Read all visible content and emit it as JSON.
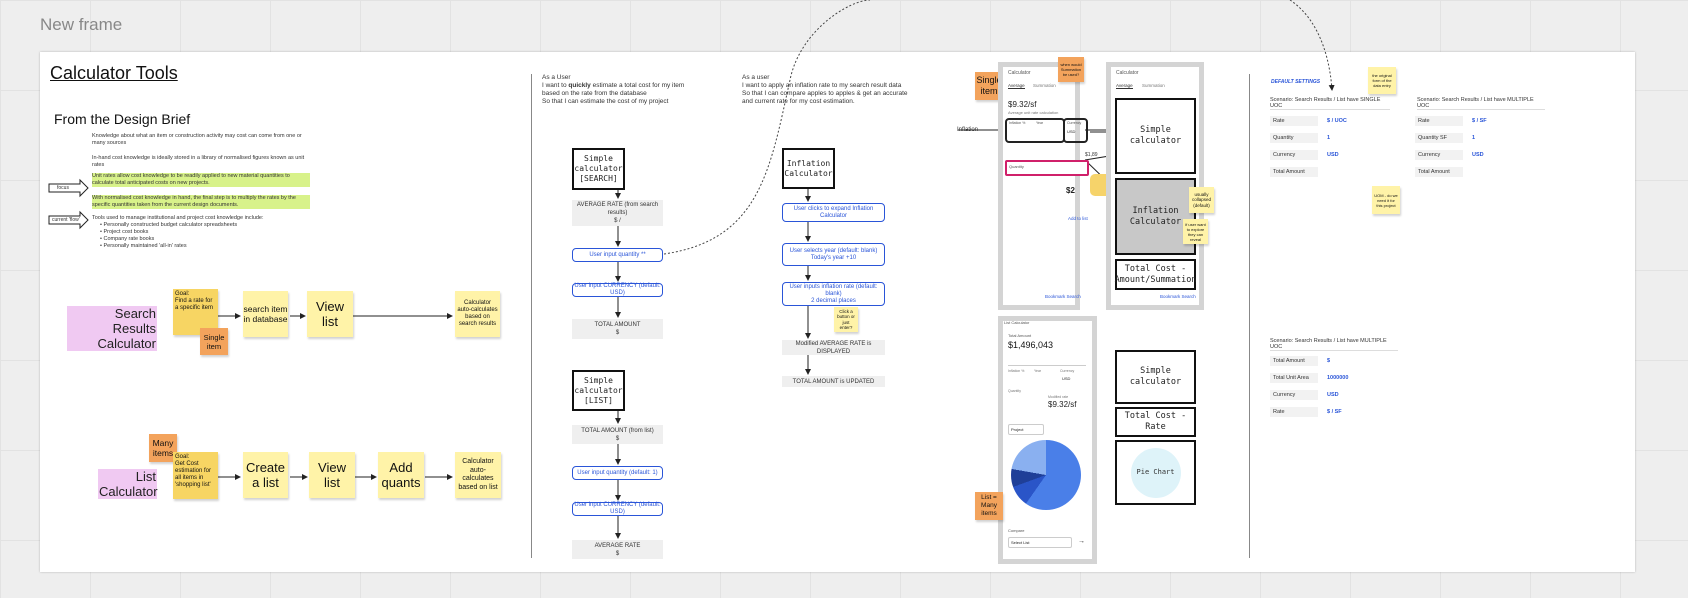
{
  "frame_label": "New frame",
  "title": "Calculator Tools",
  "design_brief": {
    "heading": "From the Design Brief",
    "para1": "Knowledge about what an item or construction activity may cost can come from one or many sources",
    "para2": "In-hand cost knowledge is ideally stored in a library of normalised figures known as unit rates",
    "para3": "Unit rates allow cost knowledge to be readily applied to new material quantities to calculate total anticipated costs on new projects.",
    "para4": "With normalised cost knowledge in hand, the final step is to multiply the rates by the specific quantities taken from the current design documents.",
    "para5": "Tools used to manage institutional and project cost knowledge include:",
    "bullets": [
      "Personally constructed budget calculator spreadsheets",
      "Project cost books",
      "Company rate books",
      "Personally maintained 'all-in' rates"
    ],
    "arrow1": "focus",
    "arrow2": "current 'flow'"
  },
  "search_flow": {
    "label": "Search Results Calculator",
    "goal": "Goal:\nFind a rate for a specific item",
    "single": "Single item",
    "step1": "search item in database",
    "step2": "View list",
    "result": "Calculator auto-calculates based on search results"
  },
  "list_flow": {
    "label": "List Calculator",
    "many": "Many items",
    "goal": "Goal:\nGet Cost estimation for all items in 'shopping list'",
    "step1": "Create a list",
    "step2": "View list",
    "step3": "Add quants",
    "result": "Calculator auto-calculates based on list"
  },
  "story1": {
    "l1": "As a User",
    "l2a": "I want to ",
    "l2b": "quickly",
    "l2c": " estimate a total cost for my item",
    "l3": "based on the rate from the database",
    "l4": "So that I can estimate the cost of my project"
  },
  "story2": {
    "l1": "As a user",
    "l2": "I want to apply an inflation rate to my search result data",
    "l3": "So that I can compare apples to apples & get an accurate",
    "l4": "and current rate for my cost estimation."
  },
  "simple_search": {
    "box": "Simple\ncalculator\n[SEARCH]",
    "avg": "AVERAGE RATE (from search results)\n$ /",
    "qty": "User input quantity **",
    "cur": "User input CURRENCY (default: USD)",
    "total": "TOTAL AMOUNT\n$"
  },
  "simple_list": {
    "box": "Simple\ncalculator\n[LIST]",
    "total": "TOTAL AMOUNT (from list)\n$",
    "qty": "User input quantity (default: 1)",
    "cur": "User input CURRENCY (default: USD)",
    "avg": "AVERAGE RATE\n$"
  },
  "inflation_flow": {
    "box": "Inflation\nCalculator",
    "expand": "User clicks to expand Inflation Calculator",
    "year": "User selects year (default: blank)\nToday's year +10",
    "rate": "User inputs inflation rate (default: blank)\n2 decimal places",
    "note": "Click a button or just enter?",
    "modified": "Modified AVERAGE RATE is DISPLAYED",
    "updated": "TOTAL AMOUNT is UPDATED"
  },
  "mockup": {
    "single": "Single item",
    "summation_note": "when would Summation be used?",
    "calc": "Calculator",
    "tab1": "Average",
    "tab2": "Summation",
    "rate": "$9.32/sf",
    "rate_sub": "Average unit rate calculation",
    "inflation": "Inflation",
    "inflation_label": "Inflation %",
    "year": "Year",
    "currency": "Currency",
    "usd": "USD",
    "quantity": "Quantity",
    "total_partial": "$1,89",
    "total_partial2": "$2",
    "add_to": "Add to list",
    "bookmark": "Bookmark Search",
    "list_many": "List = Many items",
    "list_calc": "List Calculator",
    "total_amount": "Total Amount",
    "total_value": "$1,496,043",
    "mod_rate": "Modified rate",
    "rate2": "$9.32/sf",
    "project": "Project",
    "compare": "Compare",
    "select_list": "Select List"
  },
  "wireframe": {
    "calc": "Calculator",
    "tab1": "Average",
    "tab2": "Summation",
    "simple": "Simple calculator",
    "inflation": "Inflation\nCalculator",
    "total_sum": "Total Cost -\nAmount/Summation",
    "bookmark": "Bookmark Search",
    "note1": "usually collapsed (default)",
    "note2": "if user want to explore they can reveal",
    "simple2": "Simple calculator",
    "total_rate": "Total Cost - Rate",
    "pie": "Pie Chart"
  },
  "settings": {
    "default_title": "DEFAULT SETTINGS",
    "note_data": "the original form of the data entry",
    "note_uom": "UOM - do we need it for this project",
    "single_title": "Scenario: Search Results / List have SINGLE UOC",
    "single_rows": [
      {
        "label": "Rate",
        "value": "$ / UOC"
      },
      {
        "label": "Quantity",
        "value": "1"
      },
      {
        "label": "Currency",
        "value": "USD"
      },
      {
        "label": "Total Amount",
        "value": ""
      }
    ],
    "multi_title": "Scenario: Search Results / List have MULTIPLE UOC",
    "multi_rows": [
      {
        "label": "Rate",
        "value": "$ / SF"
      },
      {
        "label": "Quantity SF",
        "value": "1"
      },
      {
        "label": "Currency",
        "value": "USD"
      },
      {
        "label": "Total Amount",
        "value": ""
      }
    ],
    "multi2_title": "Scenario: Search Results / List have MULTIPLE UOC",
    "multi2_rows": [
      {
        "label": "Total Amount",
        "value": "$"
      },
      {
        "label": "Total Unit Area",
        "value": "1000000"
      },
      {
        "label": "Currency",
        "value": "USD"
      },
      {
        "label": "Rate",
        "value": "$ / SF"
      }
    ]
  }
}
